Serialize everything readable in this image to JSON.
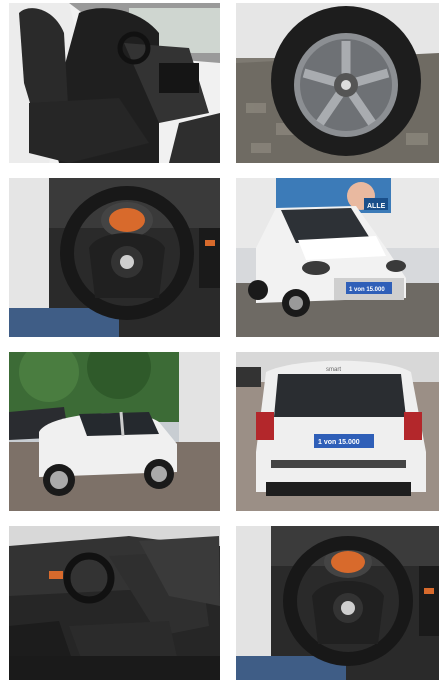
{
  "gallery": {
    "photos": [
      {
        "subject": "interior-seats"
      },
      {
        "subject": "wheel-rim"
      },
      {
        "subject": "steering-wheel"
      },
      {
        "subject": "front-exterior"
      },
      {
        "subject": "side-exterior"
      },
      {
        "subject": "rear-exterior"
      },
      {
        "subject": "interior-cabin"
      },
      {
        "subject": "steering-wheel-closeup"
      }
    ],
    "plate_front": "1 von 15.000",
    "plate_rear": "1 von 15.000",
    "brand_badge": "smart",
    "poster_text": "ALLE"
  },
  "colors": {
    "car_white": "#f2f2f2",
    "interior_dark": "#1e1e1e",
    "cobblestone": "#8c8078",
    "plate_blue": "#2f5fb8",
    "accent_orange": "#d86a2c"
  }
}
